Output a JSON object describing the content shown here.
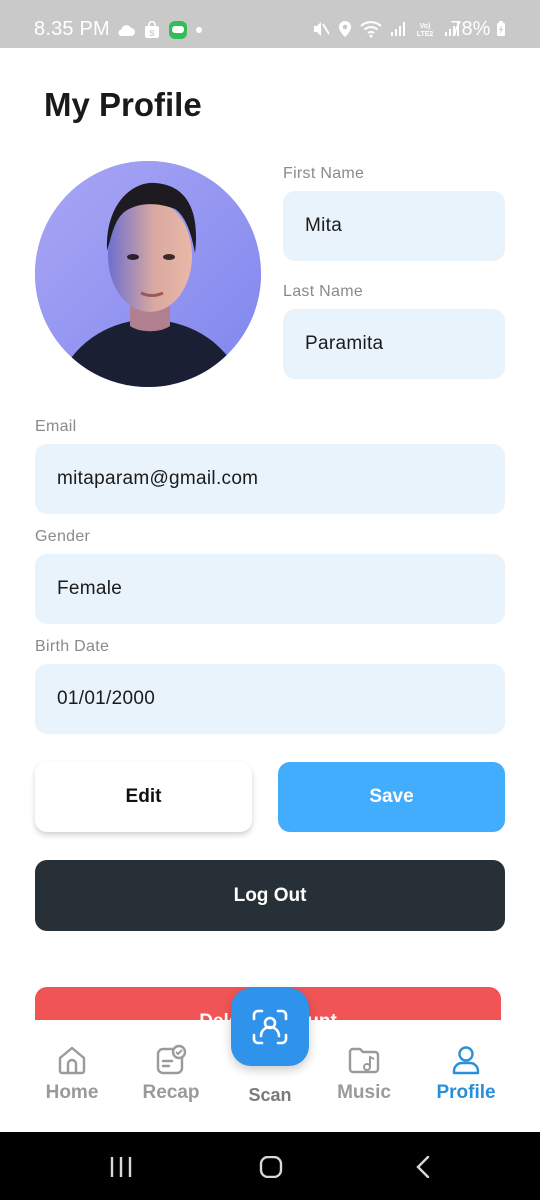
{
  "status_bar": {
    "time": "8.35 PM",
    "battery": "78%",
    "left_icons": [
      "cloud-icon",
      "shopping-bag-icon",
      "chat-app-icon",
      "dot-icon"
    ],
    "right_icons": [
      "mute-icon",
      "location-icon",
      "wifi-icon",
      "signal-icon",
      "volte-icon",
      "signal-icon",
      "battery-charging-icon"
    ]
  },
  "page": {
    "title": "My Profile"
  },
  "profile": {
    "first_name_label": "First Name",
    "first_name": "Mita",
    "last_name_label": "Last Name",
    "last_name": "Paramita",
    "email_label": "Email",
    "email": "mitaparam@gmail.com",
    "gender_label": "Gender",
    "gender": "Female",
    "birth_date_label": "Birth Date",
    "birth_date": "01/01/2000"
  },
  "actions": {
    "edit_label": "Edit",
    "save_label": "Save",
    "logout_label": "Log Out",
    "delete_label": "Delete Account"
  },
  "bottom_nav": {
    "items": [
      {
        "label": "Home",
        "icon": "home-icon"
      },
      {
        "label": "Recap",
        "icon": "recap-icon"
      },
      {
        "label": "Scan",
        "icon": "face-scan-icon"
      },
      {
        "label": "Music",
        "icon": "music-folder-icon"
      },
      {
        "label": "Profile",
        "icon": "profile-icon",
        "active": true
      }
    ]
  },
  "colors": {
    "accent": "#2a8fd9",
    "save_button": "#42adfc",
    "logout_button": "#273036",
    "delete_button": "#f15454",
    "field_background": "#e8f3fc",
    "avatar_background": "#8e90f0"
  }
}
